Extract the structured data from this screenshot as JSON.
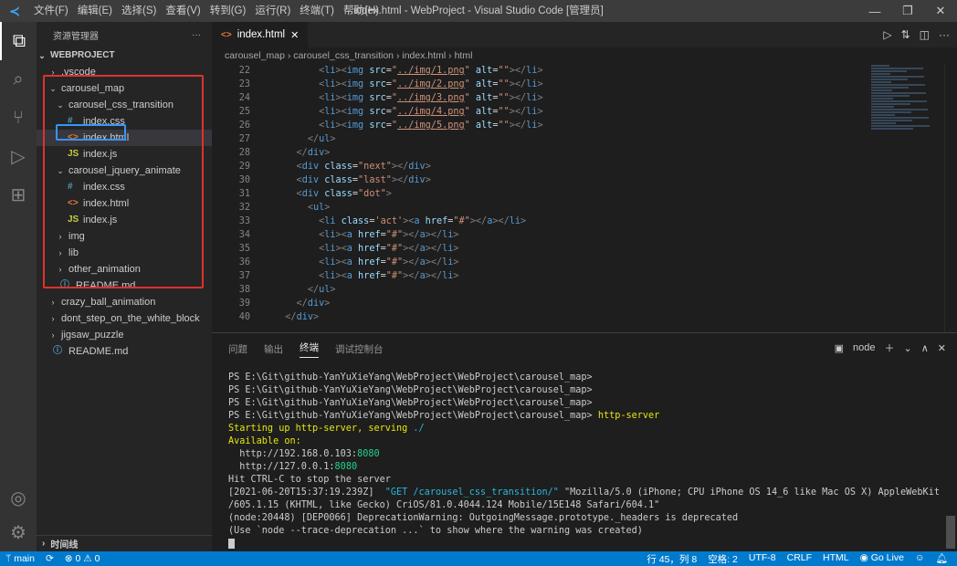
{
  "titlebar": {
    "menu": [
      "文件(F)",
      "编辑(E)",
      "选择(S)",
      "查看(V)",
      "转到(G)",
      "运行(R)",
      "终端(T)",
      "帮助(H)"
    ],
    "title": "index.html - WebProject - Visual Studio Code [管理员]"
  },
  "sidebar": {
    "header": "资源管理器",
    "more": "···",
    "root": "WEBPROJECT",
    "items": [
      {
        "label": ".vscode",
        "depth": 1,
        "kind": "folder-closed"
      },
      {
        "label": "carousel_map",
        "depth": 1,
        "kind": "folder-open"
      },
      {
        "label": "carousel_css_transition",
        "depth": 2,
        "kind": "folder-open"
      },
      {
        "label": "index.css",
        "depth": 3,
        "kind": "css"
      },
      {
        "label": "index.html",
        "depth": 3,
        "kind": "html"
      },
      {
        "label": "index.js",
        "depth": 3,
        "kind": "js"
      },
      {
        "label": "carousel_jquery_animate",
        "depth": 2,
        "kind": "folder-open"
      },
      {
        "label": "index.css",
        "depth": 3,
        "kind": "css"
      },
      {
        "label": "index.html",
        "depth": 3,
        "kind": "html"
      },
      {
        "label": "index.js",
        "depth": 3,
        "kind": "js"
      },
      {
        "label": "img",
        "depth": 2,
        "kind": "folder-closed"
      },
      {
        "label": "lib",
        "depth": 2,
        "kind": "folder-closed"
      },
      {
        "label": "other_animation",
        "depth": 2,
        "kind": "folder-closed"
      },
      {
        "label": "README.md",
        "depth": 2,
        "kind": "info"
      },
      {
        "label": "crazy_ball_animation",
        "depth": 1,
        "kind": "folder-closed"
      },
      {
        "label": "dont_step_on_the_white_block",
        "depth": 1,
        "kind": "folder-closed"
      },
      {
        "label": "jigsaw_puzzle",
        "depth": 1,
        "kind": "folder-closed"
      },
      {
        "label": "README.md",
        "depth": 1,
        "kind": "info"
      }
    ],
    "footer": "时间线"
  },
  "editor": {
    "tab": "index.html",
    "breadcrumbs": [
      "carousel_map",
      "carousel_css_transition",
      "index.html",
      "html"
    ],
    "lines": [
      22,
      23,
      24,
      25,
      26,
      27,
      28,
      29,
      30,
      31,
      32,
      33,
      34,
      35,
      36,
      37,
      38,
      39,
      40
    ],
    "code": [
      [
        [
          "t",
          "<"
        ],
        [
          "tg",
          "li"
        ],
        [
          "t",
          ">"
        ],
        [
          "t",
          "<"
        ],
        [
          "tg",
          "img"
        ],
        [
          "at",
          " src"
        ],
        [
          "eq",
          "="
        ],
        [
          "st",
          "\""
        ],
        [
          "stu",
          "../img/1.png"
        ],
        [
          "st",
          "\""
        ],
        [
          "at",
          " alt"
        ],
        [
          "eq",
          "="
        ],
        [
          "st",
          "\"\""
        ],
        [
          "t",
          ">"
        ],
        [
          "t",
          "</"
        ],
        [
          "tg",
          "li"
        ],
        [
          "t",
          ">"
        ]
      ],
      [
        [
          "t",
          "<"
        ],
        [
          "tg",
          "li"
        ],
        [
          "t",
          ">"
        ],
        [
          "t",
          "<"
        ],
        [
          "tg",
          "img"
        ],
        [
          "at",
          " src"
        ],
        [
          "eq",
          "="
        ],
        [
          "st",
          "\""
        ],
        [
          "stu",
          "../img/2.png"
        ],
        [
          "st",
          "\""
        ],
        [
          "at",
          " alt"
        ],
        [
          "eq",
          "="
        ],
        [
          "st",
          "\"\""
        ],
        [
          "t",
          ">"
        ],
        [
          "t",
          "</"
        ],
        [
          "tg",
          "li"
        ],
        [
          "t",
          ">"
        ]
      ],
      [
        [
          "t",
          "<"
        ],
        [
          "tg",
          "li"
        ],
        [
          "t",
          ">"
        ],
        [
          "t",
          "<"
        ],
        [
          "tg",
          "img"
        ],
        [
          "at",
          " src"
        ],
        [
          "eq",
          "="
        ],
        [
          "st",
          "\""
        ],
        [
          "stu",
          "../img/3.png"
        ],
        [
          "st",
          "\""
        ],
        [
          "at",
          " alt"
        ],
        [
          "eq",
          "="
        ],
        [
          "st",
          "\"\""
        ],
        [
          "t",
          ">"
        ],
        [
          "t",
          "</"
        ],
        [
          "tg",
          "li"
        ],
        [
          "t",
          ">"
        ]
      ],
      [
        [
          "t",
          "<"
        ],
        [
          "tg",
          "li"
        ],
        [
          "t",
          ">"
        ],
        [
          "t",
          "<"
        ],
        [
          "tg",
          "img"
        ],
        [
          "at",
          " src"
        ],
        [
          "eq",
          "="
        ],
        [
          "st",
          "\""
        ],
        [
          "stu",
          "../img/4.png"
        ],
        [
          "st",
          "\""
        ],
        [
          "at",
          " alt"
        ],
        [
          "eq",
          "="
        ],
        [
          "st",
          "\"\""
        ],
        [
          "t",
          ">"
        ],
        [
          "t",
          "</"
        ],
        [
          "tg",
          "li"
        ],
        [
          "t",
          ">"
        ]
      ],
      [
        [
          "t",
          "<"
        ],
        [
          "tg",
          "li"
        ],
        [
          "t",
          ">"
        ],
        [
          "t",
          "<"
        ],
        [
          "tg",
          "img"
        ],
        [
          "at",
          " src"
        ],
        [
          "eq",
          "="
        ],
        [
          "st",
          "\""
        ],
        [
          "stu",
          "../img/5.png"
        ],
        [
          "st",
          "\""
        ],
        [
          "at",
          " alt"
        ],
        [
          "eq",
          "="
        ],
        [
          "st",
          "\"\""
        ],
        [
          "t",
          ">"
        ],
        [
          "t",
          "</"
        ],
        [
          "tg",
          "li"
        ],
        [
          "t",
          ">"
        ]
      ],
      [
        [
          "t",
          "</"
        ],
        [
          "tg",
          "ul"
        ],
        [
          "t",
          ">"
        ]
      ],
      [
        [
          "t",
          "</"
        ],
        [
          "tg",
          "div"
        ],
        [
          "t",
          ">"
        ]
      ],
      [
        [
          "t",
          "<"
        ],
        [
          "tg",
          "div"
        ],
        [
          "at",
          " class"
        ],
        [
          "eq",
          "="
        ],
        [
          "st",
          "\"next\""
        ],
        [
          "t",
          ">"
        ],
        [
          "t",
          "</"
        ],
        [
          "tg",
          "div"
        ],
        [
          "t",
          ">"
        ]
      ],
      [
        [
          "t",
          "<"
        ],
        [
          "tg",
          "div"
        ],
        [
          "at",
          " class"
        ],
        [
          "eq",
          "="
        ],
        [
          "st",
          "\"last\""
        ],
        [
          "t",
          ">"
        ],
        [
          "t",
          "</"
        ],
        [
          "tg",
          "div"
        ],
        [
          "t",
          ">"
        ]
      ],
      [
        [
          "t",
          "<"
        ],
        [
          "tg",
          "div"
        ],
        [
          "at",
          " class"
        ],
        [
          "eq",
          "="
        ],
        [
          "st",
          "\"dot\""
        ],
        [
          "t",
          ">"
        ]
      ],
      [
        [
          "t",
          "<"
        ],
        [
          "tg",
          "ul"
        ],
        [
          "t",
          ">"
        ]
      ],
      [
        [
          "t",
          "<"
        ],
        [
          "tg",
          "li"
        ],
        [
          "at",
          " class"
        ],
        [
          "eq",
          "="
        ],
        [
          "st",
          "'act'"
        ],
        [
          "t",
          ">"
        ],
        [
          "t",
          "<"
        ],
        [
          "tg",
          "a"
        ],
        [
          "at",
          " href"
        ],
        [
          "eq",
          "="
        ],
        [
          "st",
          "\"#\""
        ],
        [
          "t",
          ">"
        ],
        [
          "t",
          "</"
        ],
        [
          "tg",
          "a"
        ],
        [
          "t",
          ">"
        ],
        [
          "t",
          "</"
        ],
        [
          "tg",
          "li"
        ],
        [
          "t",
          ">"
        ]
      ],
      [
        [
          "t",
          "<"
        ],
        [
          "tg",
          "li"
        ],
        [
          "t",
          ">"
        ],
        [
          "t",
          "<"
        ],
        [
          "tg",
          "a"
        ],
        [
          "at",
          " href"
        ],
        [
          "eq",
          "="
        ],
        [
          "st",
          "\"#\""
        ],
        [
          "t",
          ">"
        ],
        [
          "t",
          "</"
        ],
        [
          "tg",
          "a"
        ],
        [
          "t",
          ">"
        ],
        [
          "t",
          "</"
        ],
        [
          "tg",
          "li"
        ],
        [
          "t",
          ">"
        ]
      ],
      [
        [
          "t",
          "<"
        ],
        [
          "tg",
          "li"
        ],
        [
          "t",
          ">"
        ],
        [
          "t",
          "<"
        ],
        [
          "tg",
          "a"
        ],
        [
          "at",
          " href"
        ],
        [
          "eq",
          "="
        ],
        [
          "st",
          "\"#\""
        ],
        [
          "t",
          ">"
        ],
        [
          "t",
          "</"
        ],
        [
          "tg",
          "a"
        ],
        [
          "t",
          ">"
        ],
        [
          "t",
          "</"
        ],
        [
          "tg",
          "li"
        ],
        [
          "t",
          ">"
        ]
      ],
      [
        [
          "t",
          "<"
        ],
        [
          "tg",
          "li"
        ],
        [
          "t",
          ">"
        ],
        [
          "t",
          "<"
        ],
        [
          "tg",
          "a"
        ],
        [
          "at",
          " href"
        ],
        [
          "eq",
          "="
        ],
        [
          "st",
          "\"#\""
        ],
        [
          "t",
          ">"
        ],
        [
          "t",
          "</"
        ],
        [
          "tg",
          "a"
        ],
        [
          "t",
          ">"
        ],
        [
          "t",
          "</"
        ],
        [
          "tg",
          "li"
        ],
        [
          "t",
          ">"
        ]
      ],
      [
        [
          "t",
          "<"
        ],
        [
          "tg",
          "li"
        ],
        [
          "t",
          ">"
        ],
        [
          "t",
          "<"
        ],
        [
          "tg",
          "a"
        ],
        [
          "at",
          " href"
        ],
        [
          "eq",
          "="
        ],
        [
          "st",
          "\"#\""
        ],
        [
          "t",
          ">"
        ],
        [
          "t",
          "</"
        ],
        [
          "tg",
          "a"
        ],
        [
          "t",
          ">"
        ],
        [
          "t",
          "</"
        ],
        [
          "tg",
          "li"
        ],
        [
          "t",
          ">"
        ]
      ],
      [
        [
          "t",
          "</"
        ],
        [
          "tg",
          "ul"
        ],
        [
          "t",
          ">"
        ]
      ],
      [
        [
          "t",
          "</"
        ],
        [
          "tg",
          "div"
        ],
        [
          "t",
          ">"
        ]
      ],
      [
        [
          "t",
          "</"
        ],
        [
          "tg",
          "div"
        ],
        [
          "t",
          ">"
        ]
      ]
    ],
    "indent": [
      8,
      8,
      8,
      8,
      8,
      6,
      4,
      4,
      4,
      4,
      6,
      8,
      8,
      8,
      8,
      8,
      6,
      4,
      2
    ]
  },
  "panel": {
    "tabs": [
      "问题",
      "输出",
      "终端",
      "调试控制台"
    ],
    "active_tab": "终端",
    "terminal_selector": "node",
    "terminal": [
      [
        [
          "n",
          "PS E:\\Git\\github-YanYuXieYang\\WebProject\\WebProject\\carousel_map>"
        ]
      ],
      [
        [
          "n",
          "PS E:\\Git\\github-YanYuXieYang\\WebProject\\WebProject\\carousel_map>"
        ]
      ],
      [
        [
          "n",
          "PS E:\\Git\\github-YanYuXieYang\\WebProject\\WebProject\\carousel_map>"
        ]
      ],
      [
        [
          "n",
          "PS E:\\Git\\github-YanYuXieYang\\WebProject\\WebProject\\carousel_map> "
        ],
        [
          "yl",
          "http-server"
        ]
      ],
      [
        [
          "yl",
          "Starting up http-server, serving "
        ],
        [
          "cy",
          "./"
        ]
      ],
      [
        [
          "yl",
          "Available on:"
        ]
      ],
      [
        [
          "n",
          "  http://192.168.0.103:"
        ],
        [
          "gr",
          "8080"
        ]
      ],
      [
        [
          "n",
          "  http://127.0.0.1:"
        ],
        [
          "gr",
          "8080"
        ]
      ],
      [
        [
          "n",
          "Hit CTRL-C to stop the server"
        ]
      ],
      [
        [
          "n",
          "[2021-06-20T15:37:19.239Z]  "
        ],
        [
          "cy",
          "\"GET /carousel_css_transition/\""
        ],
        [
          "n",
          " \"Mozilla/5.0 (iPhone; CPU iPhone OS 14_6 like Mac OS X) AppleWebKit"
        ]
      ],
      [
        [
          "n",
          "/605.1.15 (KHTML, like Gecko) CriOS/81.0.4044.124 Mobile/15E148 Safari/604.1\""
        ]
      ],
      [
        [
          "n",
          "(node:20448) [DEP0066] DeprecationWarning: OutgoingMessage.prototype._headers is deprecated"
        ]
      ],
      [
        [
          "n",
          "(Use `node --trace-deprecation ...` to show where the warning was created)"
        ]
      ]
    ]
  },
  "status": {
    "branch": "main",
    "errors": "⊗ 0 ⚠ 0",
    "position": "行 45，列 8",
    "spaces": "空格: 2",
    "encoding": "UTF-8",
    "eol": "CRLF",
    "language": "HTML",
    "golive": "Go Live"
  },
  "colors": {
    "accent": "#007acc",
    "highlight_red": "#e0312d",
    "highlight_blue": "#3794ff"
  }
}
